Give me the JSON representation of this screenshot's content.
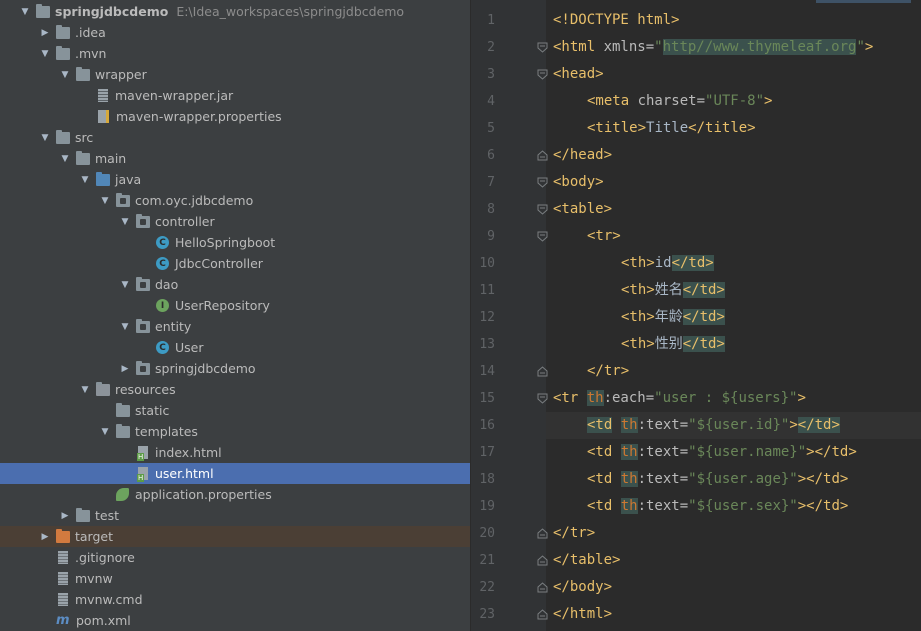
{
  "project": {
    "rows": [
      {
        "label": "springjdbcdemo",
        "path": "E:\\Idea_workspaces\\springjdbcdemo",
        "indent": 0,
        "arrow": "down",
        "icon": "folder-gray",
        "bold": true
      },
      {
        "label": ".idea",
        "indent": 1,
        "arrow": "right",
        "icon": "folder-gray"
      },
      {
        "label": ".mvn",
        "indent": 1,
        "arrow": "down",
        "icon": "folder-gray"
      },
      {
        "label": "wrapper",
        "indent": 2,
        "arrow": "down",
        "icon": "folder-gray"
      },
      {
        "label": "maven-wrapper.jar",
        "indent": 3,
        "arrow": "none",
        "icon": "jar"
      },
      {
        "label": "maven-wrapper.properties",
        "indent": 3,
        "arrow": "none",
        "icon": "props"
      },
      {
        "label": "src",
        "indent": 1,
        "arrow": "down",
        "icon": "folder-gray"
      },
      {
        "label": "main",
        "indent": 2,
        "arrow": "down",
        "icon": "folder-gray"
      },
      {
        "label": "java",
        "indent": 3,
        "arrow": "down",
        "icon": "folder-blue"
      },
      {
        "label": "com.oyc.jdbcdemo",
        "indent": 4,
        "arrow": "down",
        "icon": "package"
      },
      {
        "label": "controller",
        "indent": 5,
        "arrow": "down",
        "icon": "package"
      },
      {
        "label": "HelloSpringboot",
        "indent": 6,
        "arrow": "none",
        "icon": "class"
      },
      {
        "label": "JdbcController",
        "indent": 6,
        "arrow": "none",
        "icon": "class"
      },
      {
        "label": "dao",
        "indent": 5,
        "arrow": "down",
        "icon": "package"
      },
      {
        "label": "UserRepository",
        "indent": 6,
        "arrow": "none",
        "icon": "interface"
      },
      {
        "label": "entity",
        "indent": 5,
        "arrow": "down",
        "icon": "package"
      },
      {
        "label": "User",
        "indent": 6,
        "arrow": "none",
        "icon": "class"
      },
      {
        "label": "springjdbcdemo",
        "indent": 5,
        "arrow": "right",
        "icon": "package"
      },
      {
        "label": "resources",
        "indent": 3,
        "arrow": "down",
        "icon": "folder-res"
      },
      {
        "label": "static",
        "indent": 4,
        "arrow": "none",
        "icon": "folder-gray"
      },
      {
        "label": "templates",
        "indent": 4,
        "arrow": "down",
        "icon": "folder-gray"
      },
      {
        "label": "index.html",
        "indent": 5,
        "arrow": "none",
        "icon": "html"
      },
      {
        "label": "user.html",
        "indent": 5,
        "arrow": "none",
        "icon": "html",
        "selected": true
      },
      {
        "label": "application.properties",
        "indent": 4,
        "arrow": "none",
        "icon": "leaf"
      },
      {
        "label": "test",
        "indent": 2,
        "arrow": "right",
        "icon": "folder-gray"
      },
      {
        "label": "target",
        "indent": 1,
        "arrow": "right",
        "icon": "folder-orange",
        "excluded": true
      },
      {
        "label": ".gitignore",
        "indent": 1,
        "arrow": "none",
        "icon": "txt"
      },
      {
        "label": "mvnw",
        "indent": 1,
        "arrow": "none",
        "icon": "txt"
      },
      {
        "label": "mvnw.cmd",
        "indent": 1,
        "arrow": "none",
        "icon": "txt"
      },
      {
        "label": "pom.xml",
        "indent": 1,
        "arrow": "none",
        "icon": "maven"
      }
    ]
  },
  "editor": {
    "lines": [
      {
        "n": "1",
        "indent": 0,
        "fold": "none",
        "html": "<span class=\"tag\">&lt;!DOCTYPE html&gt;</span>"
      },
      {
        "n": "2",
        "indent": 0,
        "fold": "open",
        "html": "<span class=\"tag\">&lt;html </span><span class=\"attr\">xmlns=</span><span class=\"str\">\"<span class=\"hl\">http//www.thymeleaf.org</span>\"</span><span class=\"tag\">&gt;</span>"
      },
      {
        "n": "3",
        "indent": 0,
        "fold": "open",
        "html": "<span class=\"tag\">&lt;head&gt;</span>"
      },
      {
        "n": "4",
        "indent": 1,
        "fold": "none",
        "html": "<span class=\"tag\">&lt;meta </span><span class=\"attr\">charset=</span><span class=\"str\">\"UTF-8\"</span><span class=\"tag\">&gt;</span>"
      },
      {
        "n": "5",
        "indent": 1,
        "fold": "none",
        "html": "<span class=\"tag\">&lt;title&gt;</span>Title<span class=\"tag\">&lt;/title&gt;</span>"
      },
      {
        "n": "6",
        "indent": 0,
        "fold": "close",
        "html": "<span class=\"tag\">&lt;/head&gt;</span>"
      },
      {
        "n": "7",
        "indent": 0,
        "fold": "open",
        "html": "<span class=\"tag\">&lt;body&gt;</span>"
      },
      {
        "n": "8",
        "indent": 0,
        "fold": "open",
        "html": "<span class=\"tag\">&lt;table&gt;</span>"
      },
      {
        "n": "9",
        "indent": 1,
        "fold": "open",
        "html": "<span class=\"tag\">&lt;tr&gt;</span>"
      },
      {
        "n": "10",
        "indent": 2,
        "fold": "none",
        "html": "<span class=\"tag\">&lt;th&gt;</span>id<span class=\"tag hl\">&lt;/td&gt;</span>"
      },
      {
        "n": "11",
        "indent": 2,
        "fold": "none",
        "html": "<span class=\"tag\">&lt;th&gt;</span>姓名<span class=\"tag hl\">&lt;/td&gt;</span>"
      },
      {
        "n": "12",
        "indent": 2,
        "fold": "none",
        "html": "<span class=\"tag\">&lt;th&gt;</span>年龄<span class=\"tag hl\">&lt;/td&gt;</span>"
      },
      {
        "n": "13",
        "indent": 2,
        "fold": "none",
        "html": "<span class=\"tag\">&lt;th&gt;</span>性别<span class=\"tag hl\">&lt;/td&gt;</span>"
      },
      {
        "n": "14",
        "indent": 1,
        "fold": "close",
        "html": "<span class=\"tag\">&lt;/tr&gt;</span>"
      },
      {
        "n": "15",
        "indent": 0,
        "fold": "open",
        "html": "<span class=\"tag\">&lt;tr </span><span class=\"hl\"><span class=\"th\">th</span></span><span class=\"attr\">:each=</span><span class=\"str\">\"user : ${users}\"</span><span class=\"tag\">&gt;</span>"
      },
      {
        "n": "16",
        "indent": 1,
        "fold": "none",
        "current": true,
        "html": "<span class=\"tag hl\">&lt;td</span> <span class=\"hl\"><span class=\"th\">th</span></span><span class=\"attr\">:text=</span><span class=\"str\">\"${user.id}\"</span><span class=\"tag\">&gt;</span><span class=\"tag hl\">&lt;/td&gt;</span>"
      },
      {
        "n": "17",
        "indent": 1,
        "fold": "none",
        "html": "<span class=\"tag\">&lt;td </span><span class=\"hl\"><span class=\"th\">th</span></span><span class=\"attr\">:text=</span><span class=\"str\">\"${user.name}\"</span><span class=\"tag\">&gt;&lt;/td&gt;</span>"
      },
      {
        "n": "18",
        "indent": 1,
        "fold": "none",
        "html": "<span class=\"tag\">&lt;td </span><span class=\"hl\"><span class=\"th\">th</span></span><span class=\"attr\">:text=</span><span class=\"str\">\"${user.age}\"</span><span class=\"tag\">&gt;&lt;/td&gt;</span>"
      },
      {
        "n": "19",
        "indent": 1,
        "fold": "none",
        "html": "<span class=\"tag\">&lt;td </span><span class=\"hl\"><span class=\"th\">th</span></span><span class=\"attr\">:text=</span><span class=\"str\">\"${user.sex}\"</span><span class=\"tag\">&gt;&lt;/td&gt;</span>"
      },
      {
        "n": "20",
        "indent": 0,
        "fold": "close",
        "html": "<span class=\"tag\">&lt;/tr&gt;</span>"
      },
      {
        "n": "21",
        "indent": 0,
        "fold": "close",
        "html": "<span class=\"tag\">&lt;/table&gt;</span>"
      },
      {
        "n": "22",
        "indent": 0,
        "fold": "close",
        "html": "<span class=\"tag\">&lt;/body&gt;</span>"
      },
      {
        "n": "23",
        "indent": 0,
        "fold": "close",
        "html": "<span class=\"tag\">&lt;/html&gt;</span>"
      }
    ]
  }
}
